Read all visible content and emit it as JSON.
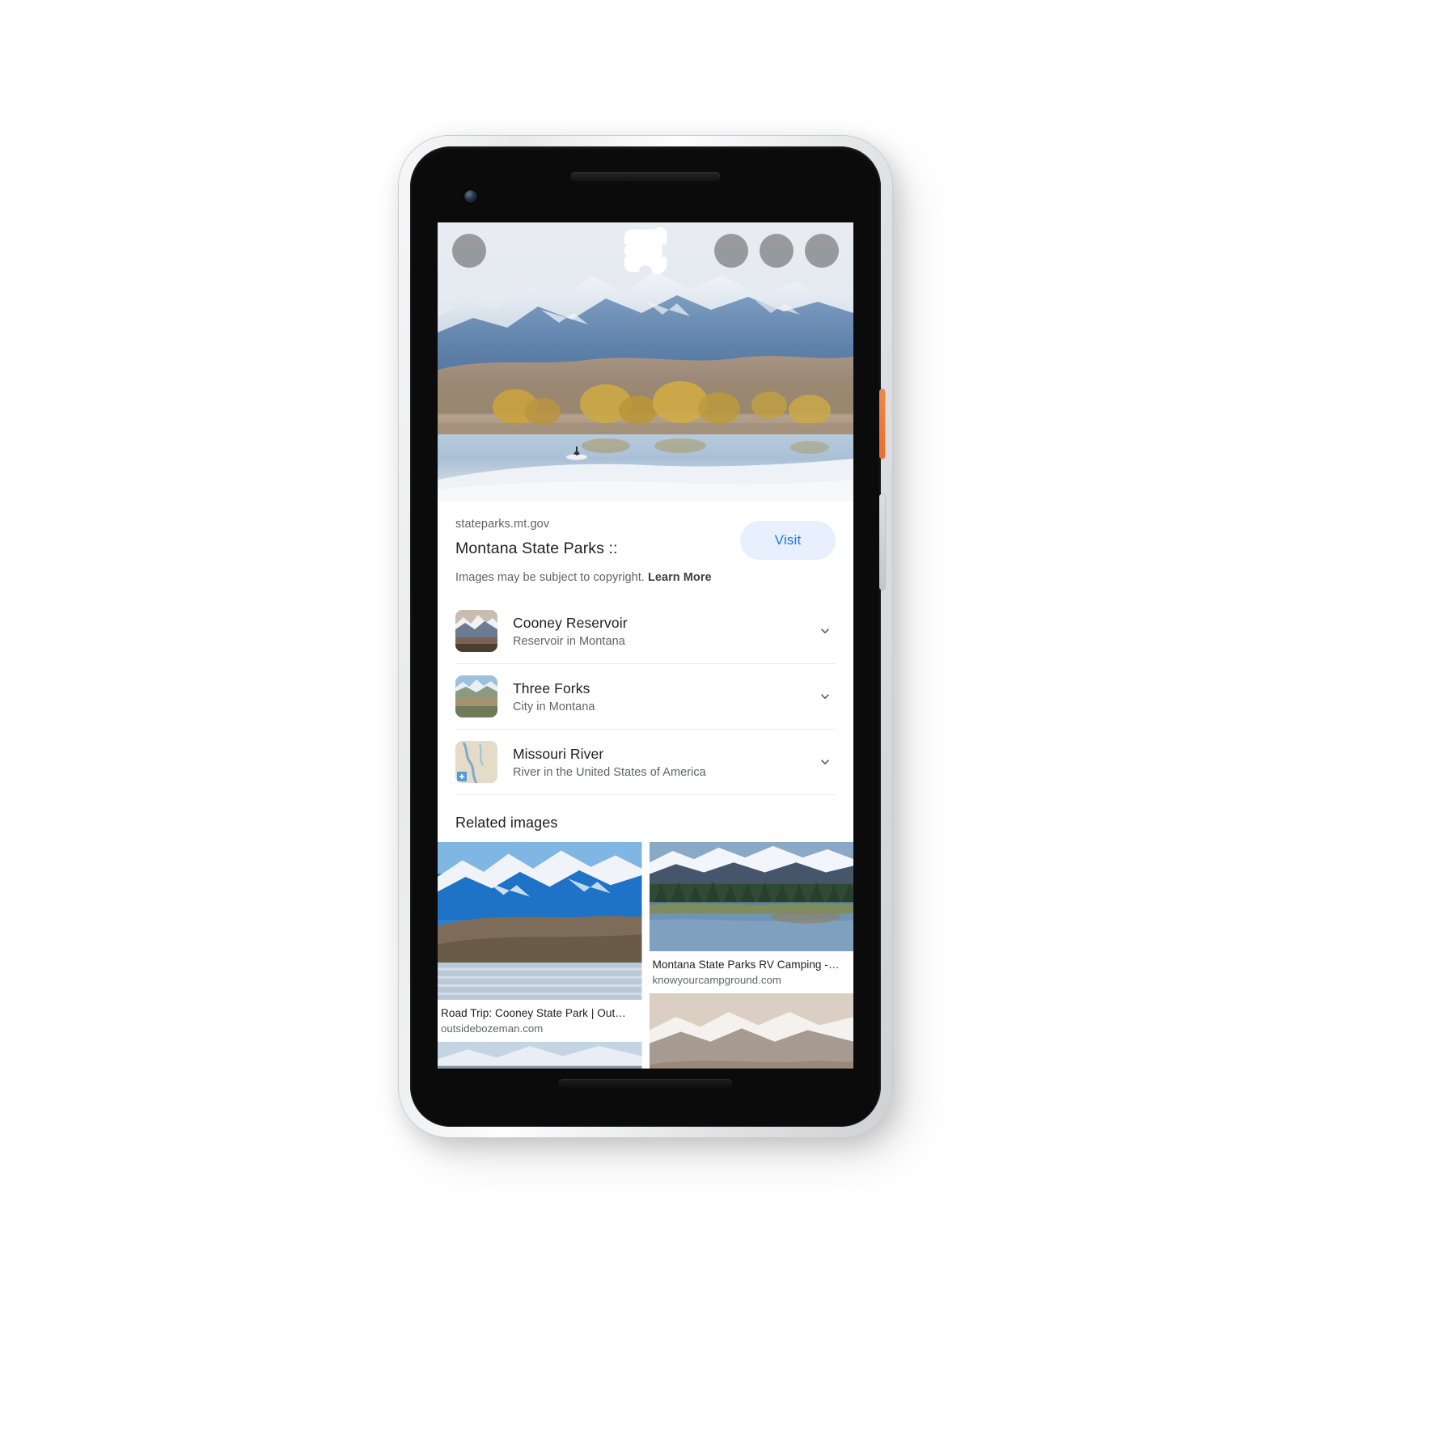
{
  "toolbar": {
    "close_label": "close-icon",
    "lens_label": "google-lens-icon",
    "share_label": "share-icon",
    "bookmark_label": "bookmark-icon"
  },
  "result": {
    "site_url": "stateparks.mt.gov",
    "title": "Montana State Parks ::",
    "copyright_text": "Images may be subject to copyright.",
    "copyright_link": "Learn More",
    "visit_label": "Visit"
  },
  "entities": [
    {
      "name": "Cooney Reservoir",
      "description": "Reservoir in Montana"
    },
    {
      "name": "Three Forks",
      "description": "City in Montana"
    },
    {
      "name": "Missouri River",
      "description": "River in the United States of America"
    }
  ],
  "related": {
    "heading": "Related images",
    "items": [
      {
        "caption": "Road Trip: Cooney State Park | Out…",
        "source": "outsidebozeman.com"
      },
      {
        "caption": "Montana State Parks RV Camping -…",
        "source": "knowyourcampground.com"
      },
      {
        "caption": "",
        "source": ""
      },
      {
        "caption": "",
        "source": ""
      }
    ]
  },
  "colors": {
    "accent_blue": "#1a73e8",
    "accent_blue_bg": "#e8f0fe",
    "text_primary": "#202124",
    "text_secondary": "#5f6368",
    "divider": "#e8eaed",
    "power_button": "#e8702f"
  }
}
